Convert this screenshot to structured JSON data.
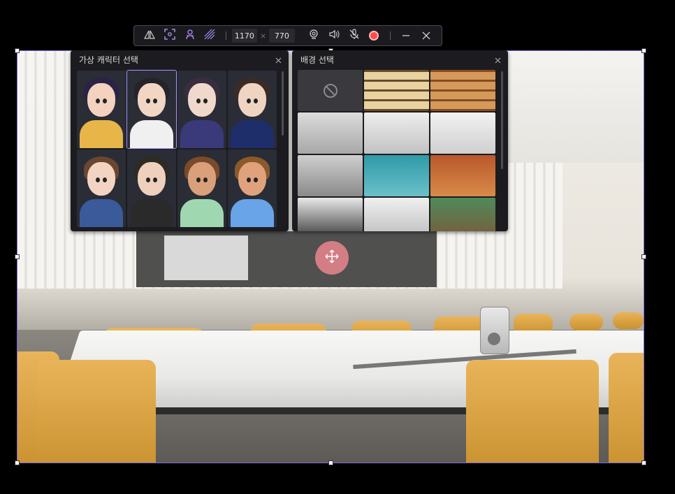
{
  "toolbar": {
    "width_value": "1170",
    "height_value": "770",
    "separator": "×",
    "tools": [
      {
        "name": "mirror-icon"
      },
      {
        "name": "focus-icon"
      },
      {
        "name": "avatar-icon"
      },
      {
        "name": "effect-icon"
      }
    ],
    "right_tools": [
      {
        "name": "webcam-icon"
      },
      {
        "name": "speaker-icon"
      },
      {
        "name": "mic-muted-icon"
      },
      {
        "name": "record-icon"
      }
    ]
  },
  "avatar_panel": {
    "title": "가상 캐릭터 선택",
    "avatars": [
      {
        "name": "avatar-anime-girl-yellow",
        "skin": "#f3d2c0",
        "hair": "#2a2346",
        "body": "#e8b548"
      },
      {
        "name": "avatar-anime-boy-white",
        "skin": "#f2d6c4",
        "hair": "#26242a",
        "body": "#f0f0f0",
        "selected": true
      },
      {
        "name": "avatar-anime-girl-blue",
        "skin": "#f1d8cc",
        "hair": "#3a2d40",
        "body": "#3a3a7a"
      },
      {
        "name": "avatar-anime-boy-navy",
        "skin": "#f0d4c2",
        "hair": "#3a2c24",
        "body": "#1e2e6a"
      },
      {
        "name": "avatar-anime-girl-hoodie",
        "skin": "#f3d4c2",
        "hair": "#6a4630",
        "body": "#3b5a9a"
      },
      {
        "name": "avatar-anime-boy-green",
        "skin": "#eed0bc",
        "hair": "#2e2a24",
        "body": "#2a2a2a"
      },
      {
        "name": "avatar-3d-girl",
        "skin": "#d9a07a",
        "hair": "#7a4a2a",
        "body": "#9fd8b0"
      },
      {
        "name": "avatar-3d-boy",
        "skin": "#e0a27c",
        "hair": "#8a5a2a",
        "body": "#6aa4e8"
      }
    ]
  },
  "background_panel": {
    "title": "배경 선택",
    "backgrounds": [
      {
        "name": "bg-none",
        "type": "none"
      },
      {
        "name": "bg-bookshelf-light",
        "colors": [
          "#6a4a2a",
          "#e8d2a0"
        ]
      },
      {
        "name": "bg-bookshelf-warm",
        "colors": [
          "#8a4a22",
          "#d49a5a"
        ]
      },
      {
        "name": "bg-conference-room",
        "colors": [
          "#dcdcdc",
          "#a8a8a8"
        ]
      },
      {
        "name": "bg-meeting-room",
        "colors": [
          "#eeeeee",
          "#c2c2c2"
        ]
      },
      {
        "name": "bg-white-studio",
        "colors": [
          "#f2f2f2",
          "#cfcfcf"
        ]
      },
      {
        "name": "bg-shadow-wall",
        "colors": [
          "#cfcfcf",
          "#8a8a8a"
        ]
      },
      {
        "name": "bg-teal-texture",
        "colors": [
          "#2f9aa8",
          "#6ac0c8"
        ]
      },
      {
        "name": "bg-brick-texture",
        "colors": [
          "#b8582a",
          "#d98a4a"
        ]
      },
      {
        "name": "bg-office-shelf",
        "colors": [
          "#e8e8e8",
          "#3a3a3a"
        ]
      },
      {
        "name": "bg-white-shelf",
        "colors": [
          "#f0f0f0",
          "#bdbdbd"
        ]
      },
      {
        "name": "bg-chalkboard",
        "colors": [
          "#4f8a5a",
          "#7a5a3a"
        ]
      }
    ]
  }
}
